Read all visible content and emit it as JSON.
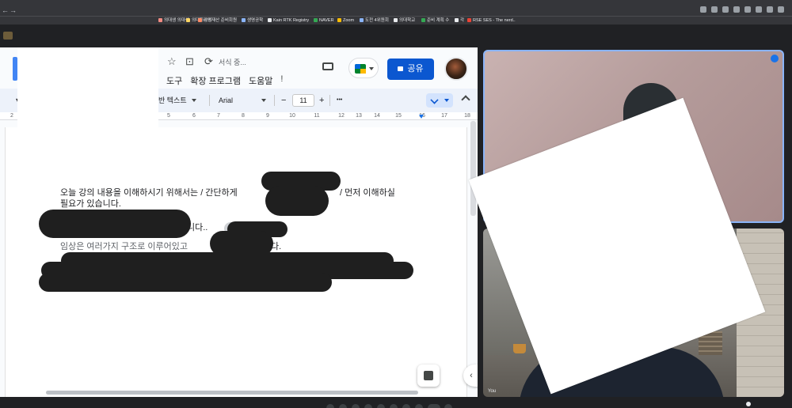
{
  "browser": {
    "nav": [
      "←",
      "→"
    ],
    "bookmarks": [
      {
        "label": "의대생 의대생",
        "color": "#f28b82"
      },
      {
        "label": "의대하사정",
        "color": "#fdd663"
      },
      {
        "label": "강의재산 준비회원",
        "color": "#ff8a65"
      },
      {
        "label": "생명공학",
        "color": "#8ab4f8"
      },
      {
        "label": "Kain RTK Registry",
        "color": "#e8eaed"
      },
      {
        "label": "NAVER",
        "color": "#34a853"
      },
      {
        "label": "Zoom",
        "color": "#fbbc04"
      },
      {
        "label": "도전 4위원회",
        "color": "#8ab4f8"
      },
      {
        "label": "의대학교",
        "color": "#e8eaed"
      },
      {
        "label": "준비 계획 수",
        "color": "#34a853"
      },
      {
        "label": "각",
        "color": "#e8eaed"
      },
      {
        "label": "RSE SES - The nerd..",
        "color": "#ea4335"
      }
    ]
  },
  "docs": {
    "autosave": "서식 중...",
    "menu": [
      "도구",
      "확장 프로그램",
      "도움말"
    ],
    "share_label": "공유",
    "toolbar": {
      "style": "반 텍스트",
      "font": "Arial",
      "minus": "−",
      "font_size": "11",
      "plus": "+",
      "more": "•••"
    },
    "ruler": [
      "2",
      "5",
      "6",
      "7",
      "8",
      "9",
      "10",
      "11",
      "12",
      "13",
      "14",
      "15",
      "16",
      "17",
      "18"
    ],
    "body": {
      "line1": "오늘 강의 내용을 이해하시기 위해서는  / 간단하게",
      "line1_end": "/ 먼저 이해하실",
      "line2": "필요가 있습니다.",
      "line3_end": "니다..",
      "line4": "임상은 여러가지 구조로 이루어있고",
      "line4_end": "다."
    }
  },
  "meet": {
    "self_label": "You"
  }
}
